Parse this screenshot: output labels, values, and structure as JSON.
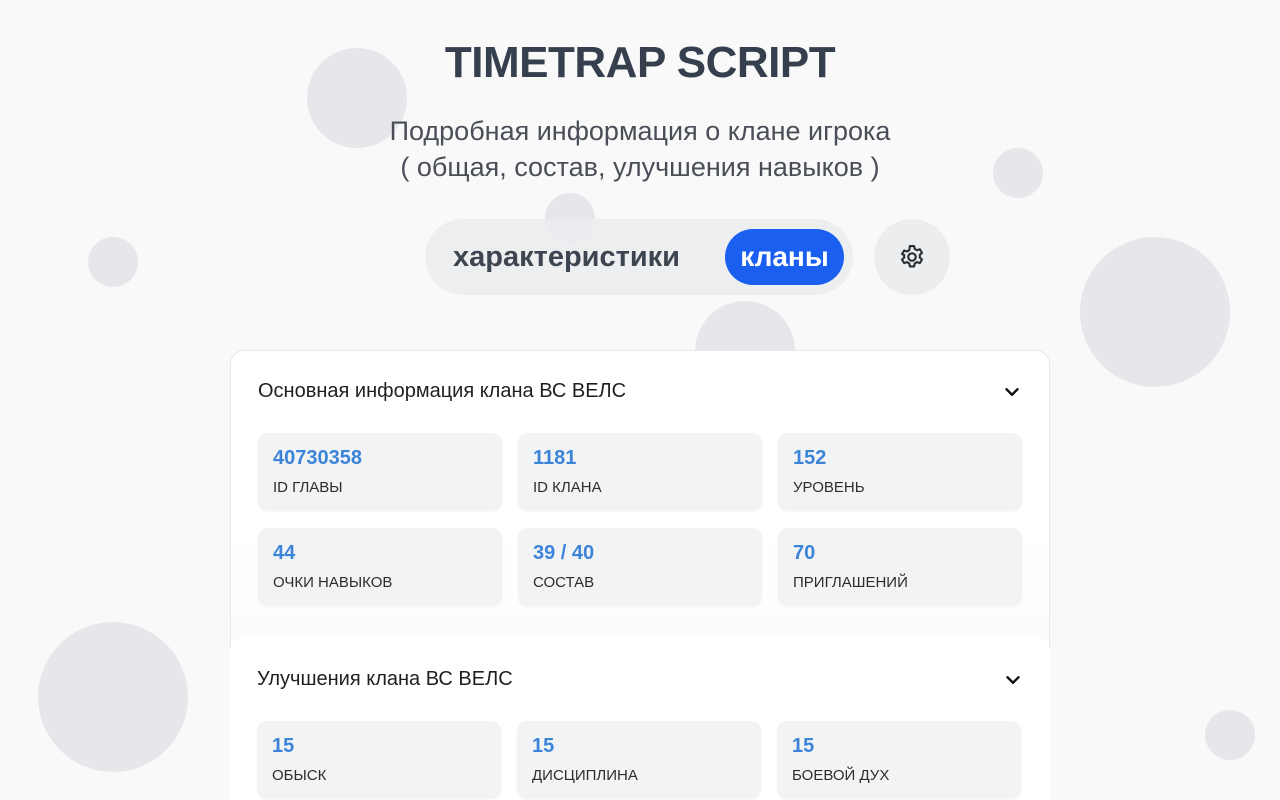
{
  "header": {
    "title": "TIMETRAP SCRIPT",
    "subtitle_line1": "Подробная информация о клане игрока",
    "subtitle_line2": "( общая, состав, улучшения навыков )"
  },
  "nav": {
    "tabs": [
      {
        "label": "характеристики",
        "active": false
      },
      {
        "label": "кланы",
        "active": true
      }
    ],
    "settings_icon": "gear-icon"
  },
  "colors": {
    "accent": "#1a5ff0",
    "value_text": "#3b84d8",
    "title_text": "#353f4d"
  },
  "sections": [
    {
      "title": "Основная информация клана ВС ВЕЛС",
      "toggle_icon": "chevron-down-icon",
      "stats": [
        {
          "value": "40730358",
          "label": "ID ГЛАВЫ"
        },
        {
          "value": "1181",
          "label": "ID КЛАНА"
        },
        {
          "value": "152",
          "label": "УРОВЕНЬ"
        },
        {
          "value": "44",
          "label": "ОЧКИ НАВЫКОВ"
        },
        {
          "value": "39 / 40",
          "label": "СОСТАВ"
        },
        {
          "value": "70",
          "label": "ПРИГЛАШЕНИЙ"
        }
      ]
    },
    {
      "title": "Улучшения клана ВС ВЕЛС",
      "toggle_icon": "chevron-down-icon",
      "stats": [
        {
          "value": "15",
          "label": "ОБЫСК"
        },
        {
          "value": "15",
          "label": "ДИСЦИПЛИНА"
        },
        {
          "value": "15",
          "label": "БОЕВОЙ ДУХ"
        }
      ]
    }
  ]
}
